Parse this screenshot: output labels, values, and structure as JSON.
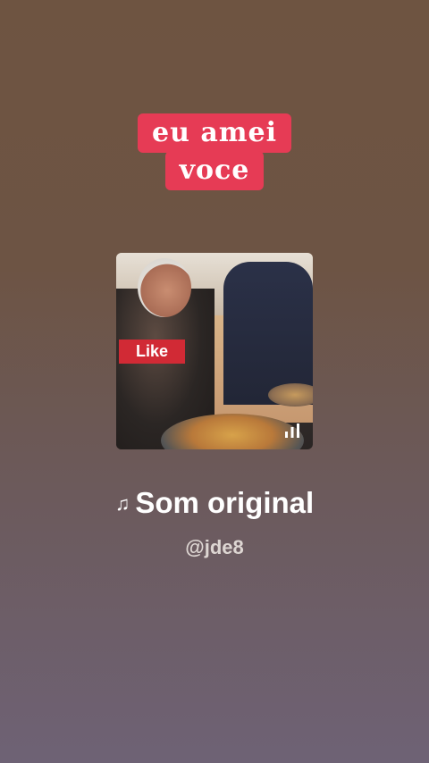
{
  "sticker": {
    "line1": "eu amei",
    "line2": "voce"
  },
  "thumbnail": {
    "like_label": "Like"
  },
  "audio": {
    "title": "Som original",
    "handle": "@jde8"
  },
  "icons": {
    "note": "music-note-icon",
    "bars": "audio-bars-icon"
  },
  "colors": {
    "sticker_bg": "#e63b55",
    "like_bg": "#d12a35"
  }
}
